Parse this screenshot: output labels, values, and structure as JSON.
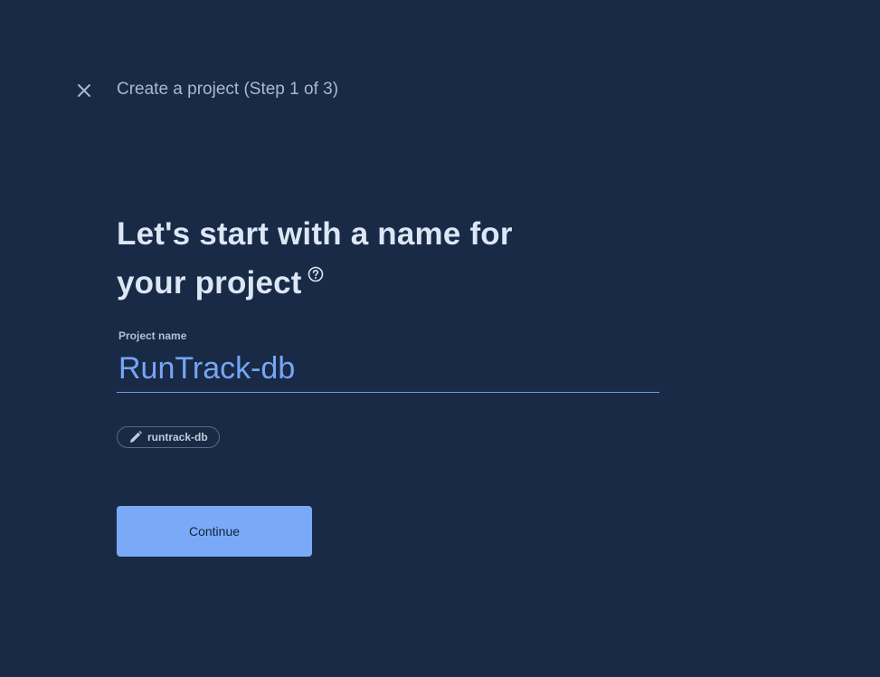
{
  "header": {
    "close_icon": "close-icon",
    "title": "Create a project (Step 1 of 3)"
  },
  "main": {
    "heading_line1": "Let's start with a name for",
    "heading_line2": "your project",
    "help_icon": "help-circle-icon"
  },
  "form": {
    "project_name_label": "Project name",
    "project_name_value": "RunTrack-db",
    "project_id_icon": "pencil-icon",
    "project_id": "runtrack-db"
  },
  "actions": {
    "continue_label": "Continue"
  },
  "colors": {
    "background": "#182a45",
    "accent": "#7aaaf7",
    "input_text": "#77a5f5"
  }
}
